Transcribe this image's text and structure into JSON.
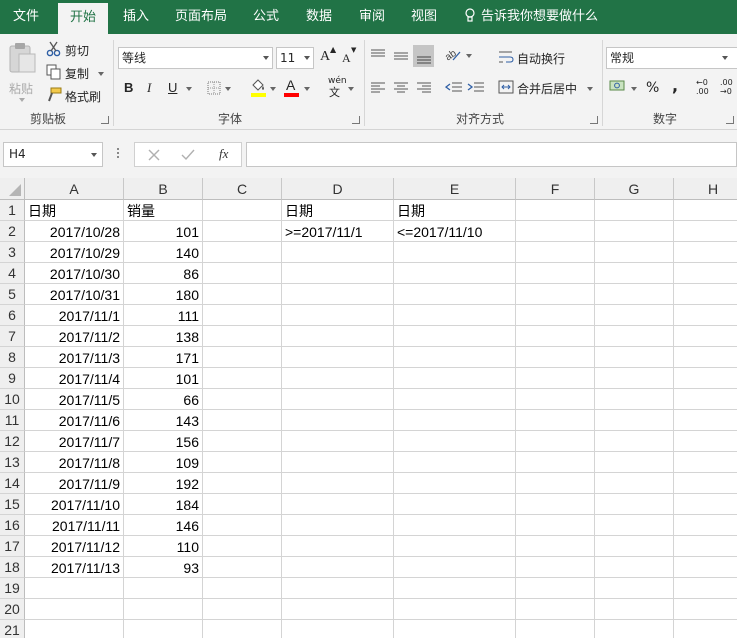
{
  "tabs": [
    {
      "label": "文件",
      "active": false
    },
    {
      "label": "开始",
      "active": true
    },
    {
      "label": "插入",
      "active": false
    },
    {
      "label": "页面布局",
      "active": false
    },
    {
      "label": "公式",
      "active": false
    },
    {
      "label": "数据",
      "active": false
    },
    {
      "label": "审阅",
      "active": false
    },
    {
      "label": "视图",
      "active": false
    }
  ],
  "tell_me": "告诉我你想要做什么",
  "ribbon": {
    "clipboard": {
      "paste": "粘贴",
      "cut": "剪切",
      "copy": "复制",
      "format_painter": "格式刷",
      "group_label": "剪贴板"
    },
    "font": {
      "font_name": "等线",
      "font_size": "11",
      "bold": "B",
      "italic": "I",
      "underline": "U",
      "phonetic": "wén",
      "group_label": "字体",
      "fill_color": "#ffff00",
      "font_color": "#ff0000"
    },
    "alignment": {
      "wrap_text": "自动换行",
      "merge_center": "合并后居中",
      "group_label": "对齐方式"
    },
    "number": {
      "format": "常规",
      "percent": "%",
      "comma": ",",
      "group_label": "数字"
    }
  },
  "formula_bar": {
    "name_box": "H4",
    "fx": "fx",
    "formula": ""
  },
  "sheet": {
    "columns": [
      "A",
      "B",
      "C",
      "D",
      "E",
      "F",
      "G",
      "H"
    ],
    "rows": [
      "1",
      "2",
      "3",
      "4",
      "5",
      "6",
      "7",
      "8",
      "9",
      "10",
      "11",
      "12",
      "13",
      "14",
      "15",
      "16",
      "17",
      "18",
      "19",
      "20",
      "21"
    ],
    "header_date": "日期",
    "header_sales": "销量",
    "records": [
      {
        "date": "2017/10/28",
        "sales": "101"
      },
      {
        "date": "2017/10/29",
        "sales": "140"
      },
      {
        "date": "2017/10/30",
        "sales": "86"
      },
      {
        "date": "2017/10/31",
        "sales": "180"
      },
      {
        "date": "2017/11/1",
        "sales": "111"
      },
      {
        "date": "2017/11/2",
        "sales": "138"
      },
      {
        "date": "2017/11/3",
        "sales": "171"
      },
      {
        "date": "2017/11/4",
        "sales": "101"
      },
      {
        "date": "2017/11/5",
        "sales": "66"
      },
      {
        "date": "2017/11/6",
        "sales": "143"
      },
      {
        "date": "2017/11/7",
        "sales": "156"
      },
      {
        "date": "2017/11/8",
        "sales": "109"
      },
      {
        "date": "2017/11/9",
        "sales": "192"
      },
      {
        "date": "2017/11/10",
        "sales": "184"
      },
      {
        "date": "2017/11/11",
        "sales": "146"
      },
      {
        "date": "2017/11/12",
        "sales": "110"
      },
      {
        "date": "2017/11/13",
        "sales": "93"
      }
    ],
    "criteria": {
      "d1": "日期",
      "e1": "日期",
      "d2": ">=2017/11/1",
      "e2": "<=2017/11/10"
    }
  },
  "colors": {
    "excel_green": "#217346",
    "ribbon_bg": "#f3f3f3",
    "header_bg": "#efefef",
    "gridline": "#d4d4d4"
  }
}
